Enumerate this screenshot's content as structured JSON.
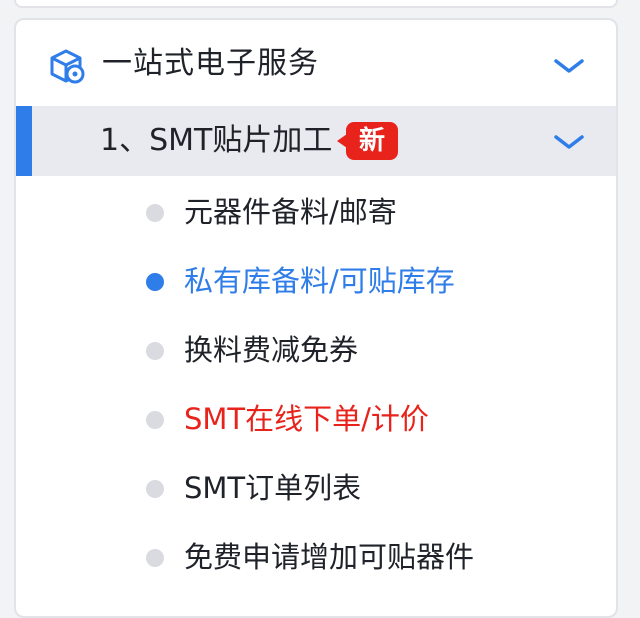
{
  "colors": {
    "accent": "#2f7de8",
    "active_text": "#2f7de8",
    "highlight_text": "#e8231c",
    "badge_bg": "#e8231c",
    "default_text": "#1f2329",
    "inactive_dot": "#d9dbe0"
  },
  "section": {
    "icon": "package-gear-icon",
    "title": "一站式电子服务",
    "toggle_icon": "chevron-down-icon"
  },
  "subsection": {
    "title": "1、SMT贴片加工",
    "badge": "新",
    "toggle_icon": "chevron-down-icon"
  },
  "menu": {
    "items": [
      {
        "label": "元器件备料/邮寄",
        "state": "default"
      },
      {
        "label": "私有库备料/可贴库存",
        "state": "active"
      },
      {
        "label": "换料费减免券",
        "state": "default"
      },
      {
        "label": "SMT在线下单/计价",
        "state": "highlight"
      },
      {
        "label": "SMT订单列表",
        "state": "default"
      },
      {
        "label": "免费申请增加可贴器件",
        "state": "default"
      }
    ]
  }
}
